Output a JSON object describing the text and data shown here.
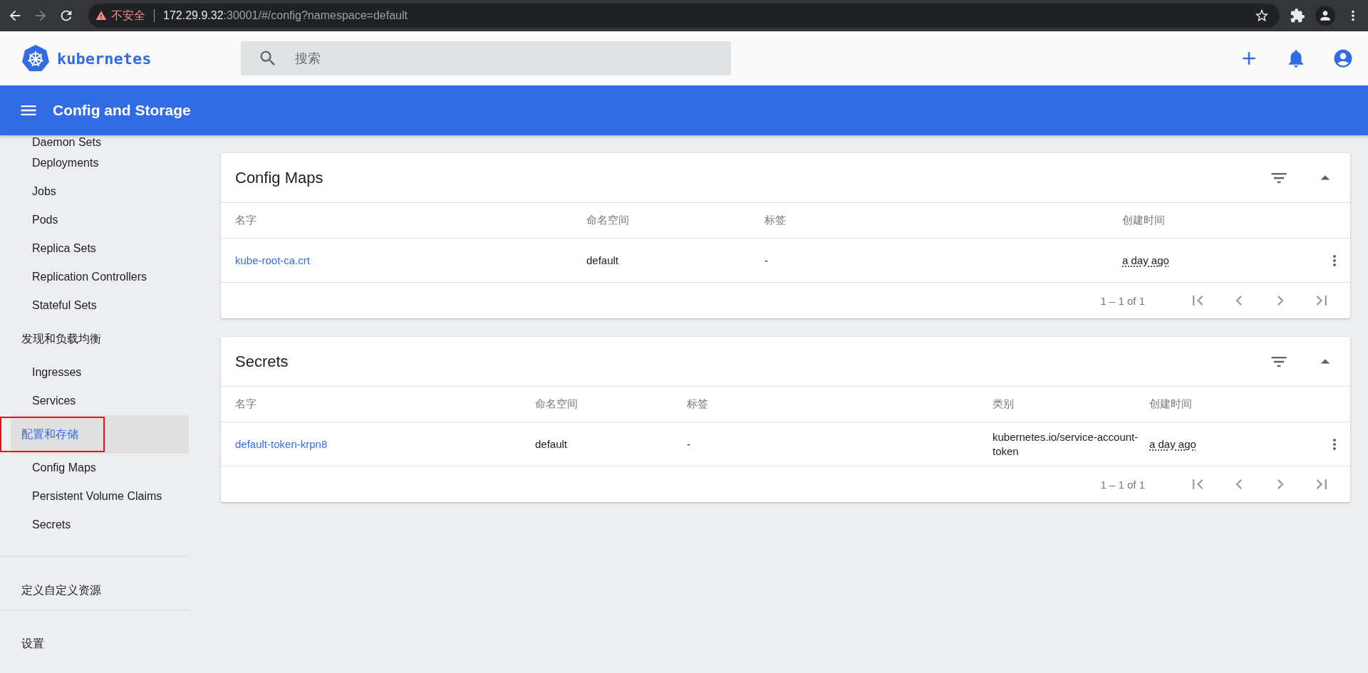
{
  "browser": {
    "security_label": "不安全",
    "address": {
      "host": "172.29.9.32",
      "path": ":30001/#/config?namespace=default"
    }
  },
  "header": {
    "brand": "kubernetes",
    "search": {
      "placeholder": "搜索"
    }
  },
  "toolbar": {
    "title": "Config and Storage"
  },
  "sidebar": {
    "sections": [
      {
        "items": [
          {
            "label": "Daemon Sets",
            "selected": false
          },
          {
            "label": "Deployments",
            "selected": false
          },
          {
            "label": "Jobs",
            "selected": false
          },
          {
            "label": "Pods",
            "selected": false
          },
          {
            "label": "Replica Sets",
            "selected": false
          },
          {
            "label": "Replication Controllers",
            "selected": false
          },
          {
            "label": "Stateful Sets",
            "selected": false
          }
        ]
      },
      {
        "label": "发现和负载均衡",
        "selected": false,
        "items": [
          {
            "label": "Ingresses",
            "selected": false
          },
          {
            "label": "Services",
            "selected": false
          }
        ]
      },
      {
        "label": "配置和存储",
        "selected": true,
        "annotated": true,
        "items": [
          {
            "label": "Config Maps",
            "selected": false
          },
          {
            "label": "Persistent Volume Claims",
            "selected": false
          },
          {
            "label": "Secrets",
            "selected": false
          }
        ]
      },
      {
        "label": "定义自定义资源",
        "selected": false,
        "divider_above": true
      },
      {
        "label": "设置",
        "selected": false,
        "divider_above": true
      }
    ]
  },
  "cards": [
    {
      "title": "Config Maps",
      "columns": [
        {
          "label": "名字",
          "kind": "link"
        },
        {
          "label": "命名空间",
          "kind": "text"
        },
        {
          "label": "标签",
          "kind": "text"
        },
        {
          "label": "创建时间",
          "kind": "time"
        }
      ],
      "rows": [
        {
          "cells": [
            "kube-root-ca.crt",
            "default",
            "-",
            "a day ago"
          ]
        }
      ],
      "pagination": "1 – 1 of 1"
    },
    {
      "title": "Secrets",
      "columns": [
        {
          "label": "名字",
          "kind": "link"
        },
        {
          "label": "命名空间",
          "kind": "text"
        },
        {
          "label": "标签",
          "kind": "text"
        },
        {
          "label": "类别",
          "kind": "text"
        },
        {
          "label": "创建时间",
          "kind": "time"
        }
      ],
      "rows": [
        {
          "cells": [
            "default-token-krpn8",
            "default",
            "-",
            "kubernetes.io/service-account-token",
            "a day ago"
          ]
        }
      ],
      "pagination": "1 – 1 of 1"
    }
  ]
}
